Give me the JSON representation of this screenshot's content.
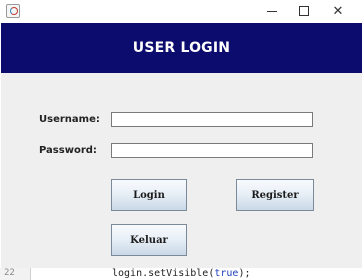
{
  "window": {
    "icon": "java-app-icon",
    "controls": {
      "minimize": "minimize-icon",
      "maximize": "maximize-icon",
      "close": "close-icon",
      "close_glyph": "✕"
    }
  },
  "banner": {
    "title": "USER LOGIN",
    "background": "#0c0c6e",
    "text_color": "#ffffff"
  },
  "form": {
    "username_label": "Username:",
    "username_value": "",
    "password_label": "Password:",
    "password_value": ""
  },
  "buttons": {
    "login": "Login",
    "register": "Register",
    "keluar": "Keluar"
  },
  "background_editor": {
    "line_number": "22",
    "code_prefix": "login.setVisible(",
    "code_keyword": "true",
    "code_suffix": ");"
  }
}
